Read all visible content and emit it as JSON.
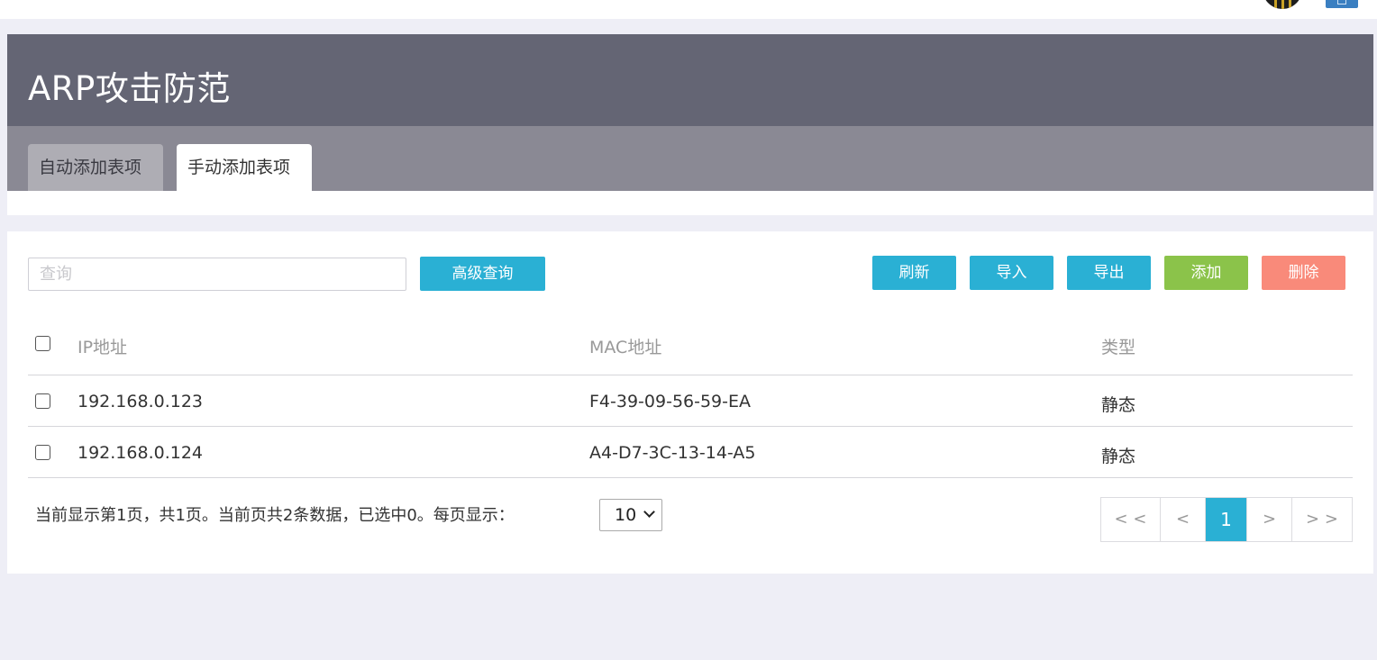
{
  "page": {
    "title": "ARP攻击防范",
    "tabs": [
      {
        "label": "自动添加表项",
        "active": false
      },
      {
        "label": "手动添加表项",
        "active": true
      }
    ]
  },
  "toolbar": {
    "search_placeholder": "查询",
    "search_value": "",
    "advanced_search_label": "高级查询",
    "refresh_label": "刷新",
    "import_label": "导入",
    "export_label": "导出",
    "add_label": "添加",
    "delete_label": "删除"
  },
  "table": {
    "columns": [
      "IP地址",
      "MAC地址",
      "类型"
    ],
    "rows": [
      {
        "ip": "192.168.0.123",
        "mac": "F4-39-09-56-59-EA",
        "type": "静态",
        "checked": false
      },
      {
        "ip": "192.168.0.124",
        "mac": "A4-D7-3C-13-14-A5",
        "type": "静态",
        "checked": false
      }
    ]
  },
  "pagination": {
    "info": "当前显示第1页，共1页。当前页共2条数据，已选中0。每页显示：",
    "page_size": "10",
    "first": "< <",
    "prev": "<",
    "current": "1",
    "next": ">",
    "last": "> >"
  },
  "colors": {
    "title_bar": "#646574",
    "tab_bar": "#8a8994",
    "accent_blue": "#2ab0d4",
    "add_green": "#8bc34a",
    "delete_red": "#f98a7a"
  }
}
